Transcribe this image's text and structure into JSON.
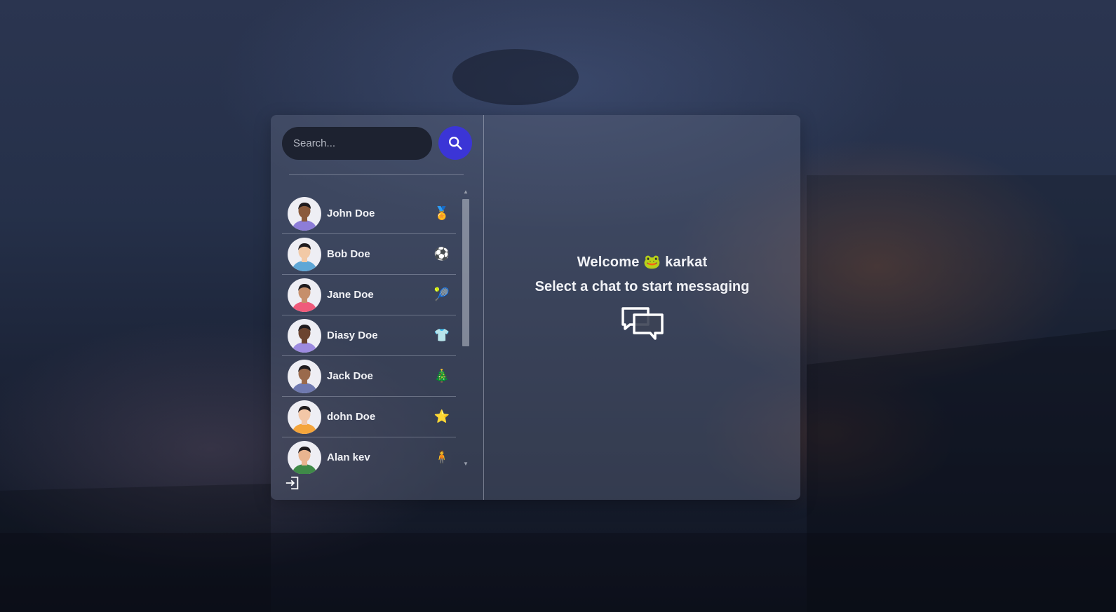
{
  "search": {
    "placeholder": "Search..."
  },
  "chats": [
    {
      "name": "John Doe",
      "emoji": "🏅",
      "avatar_color": "#8d7dd8",
      "skin": "#8a5a3c"
    },
    {
      "name": "Bob Doe",
      "emoji": "⚽",
      "avatar_color": "#5fa7d6",
      "skin": "#f2c9a6"
    },
    {
      "name": "Jane Doe",
      "emoji": "🎾",
      "avatar_color": "#ef5b7b",
      "skin": "#c68f6b"
    },
    {
      "name": "Diasy Doe",
      "emoji": "👕",
      "avatar_color": "#9d8be0",
      "skin": "#6b4430"
    },
    {
      "name": "Jack Doe",
      "emoji": "🎄",
      "avatar_color": "#6f79b0",
      "skin": "#9a6a4c"
    },
    {
      "name": "dohn Doe",
      "emoji": "⭐",
      "avatar_color": "#f4a53c",
      "skin": "#f3c7a7"
    },
    {
      "name": "Alan kev",
      "emoji": "🧍",
      "avatar_color": "#3f8a48",
      "skin": "#e9b48f"
    }
  ],
  "main": {
    "welcome_prefix": "Welcome",
    "welcome_emoji": "🐸",
    "username": "karkat",
    "subtitle": "Select a chat to start messaging"
  },
  "colors": {
    "accent": "#3b35d6",
    "search_bg": "#1d2230"
  }
}
